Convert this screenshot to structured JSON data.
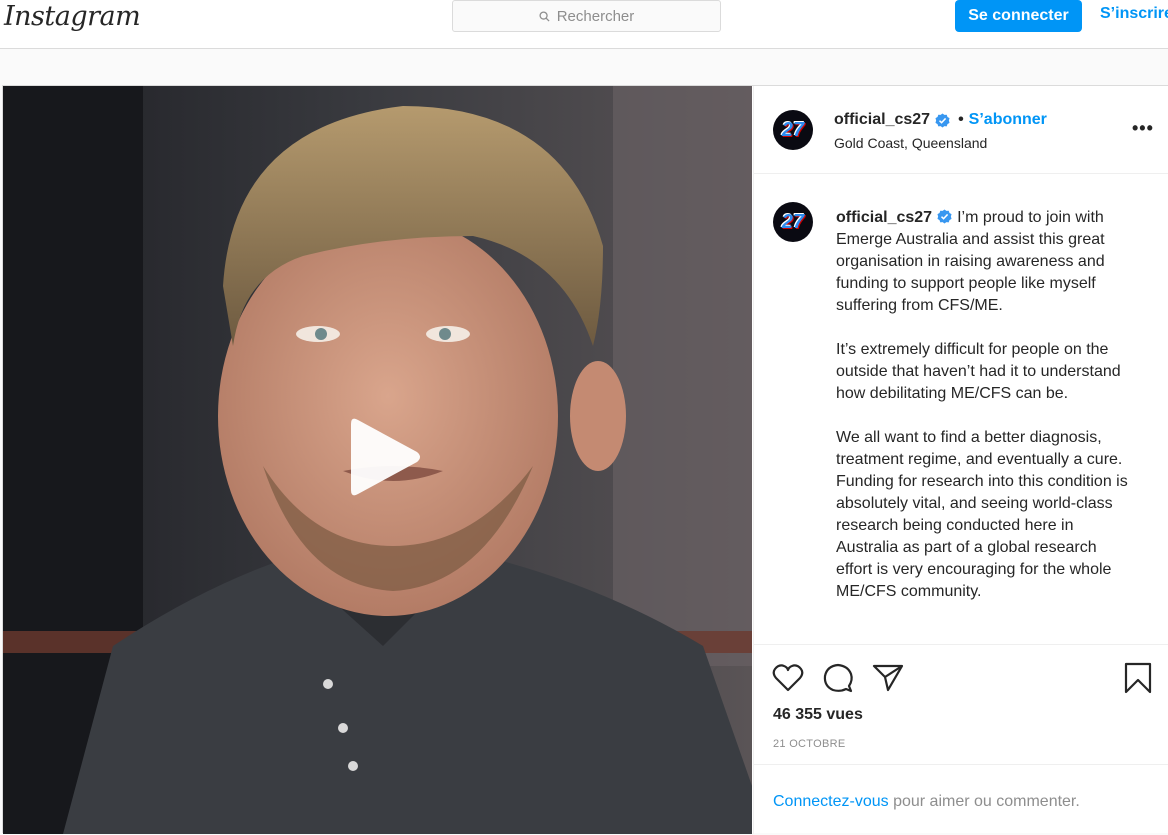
{
  "nav": {
    "logo": "Instagram",
    "search_placeholder": "Rechercher",
    "connect_label": "Se connecter",
    "signup_label": "S’inscrire"
  },
  "post": {
    "username": "official_cs27",
    "follow_label": "S’abonner",
    "location": "Gold Coast, Queensland",
    "avatar_text": "27",
    "caption_paragraphs": [
      "I’m proud to join with Emerge Australia and assist this great organisation in raising awareness and funding to support people like myself suffering from CFS/ME.",
      "It’s extremely difficult for people on the outside that haven’t had it to understand how debilitating ME/CFS can be.",
      "We all want to find a better diagnosis, treatment regime, and eventually a cure. Funding for research into this condition is absolutely vital, and seeing world-class research being conducted here in Australia as part of a global research effort is very encouraging for the whole ME/CFS community."
    ],
    "views": "46 355 vues",
    "date": "21 OCTOBRE",
    "login_link": "Connectez-vous",
    "login_rest": " pour aimer ou commenter."
  },
  "colors": {
    "accent": "#0095f6",
    "verified": "#3897f0",
    "border": "#dbdbdb"
  },
  "icons": [
    "search-icon",
    "verified-badge-icon",
    "more-options-icon",
    "play-icon",
    "heart-icon",
    "comment-icon",
    "share-icon",
    "bookmark-icon"
  ]
}
